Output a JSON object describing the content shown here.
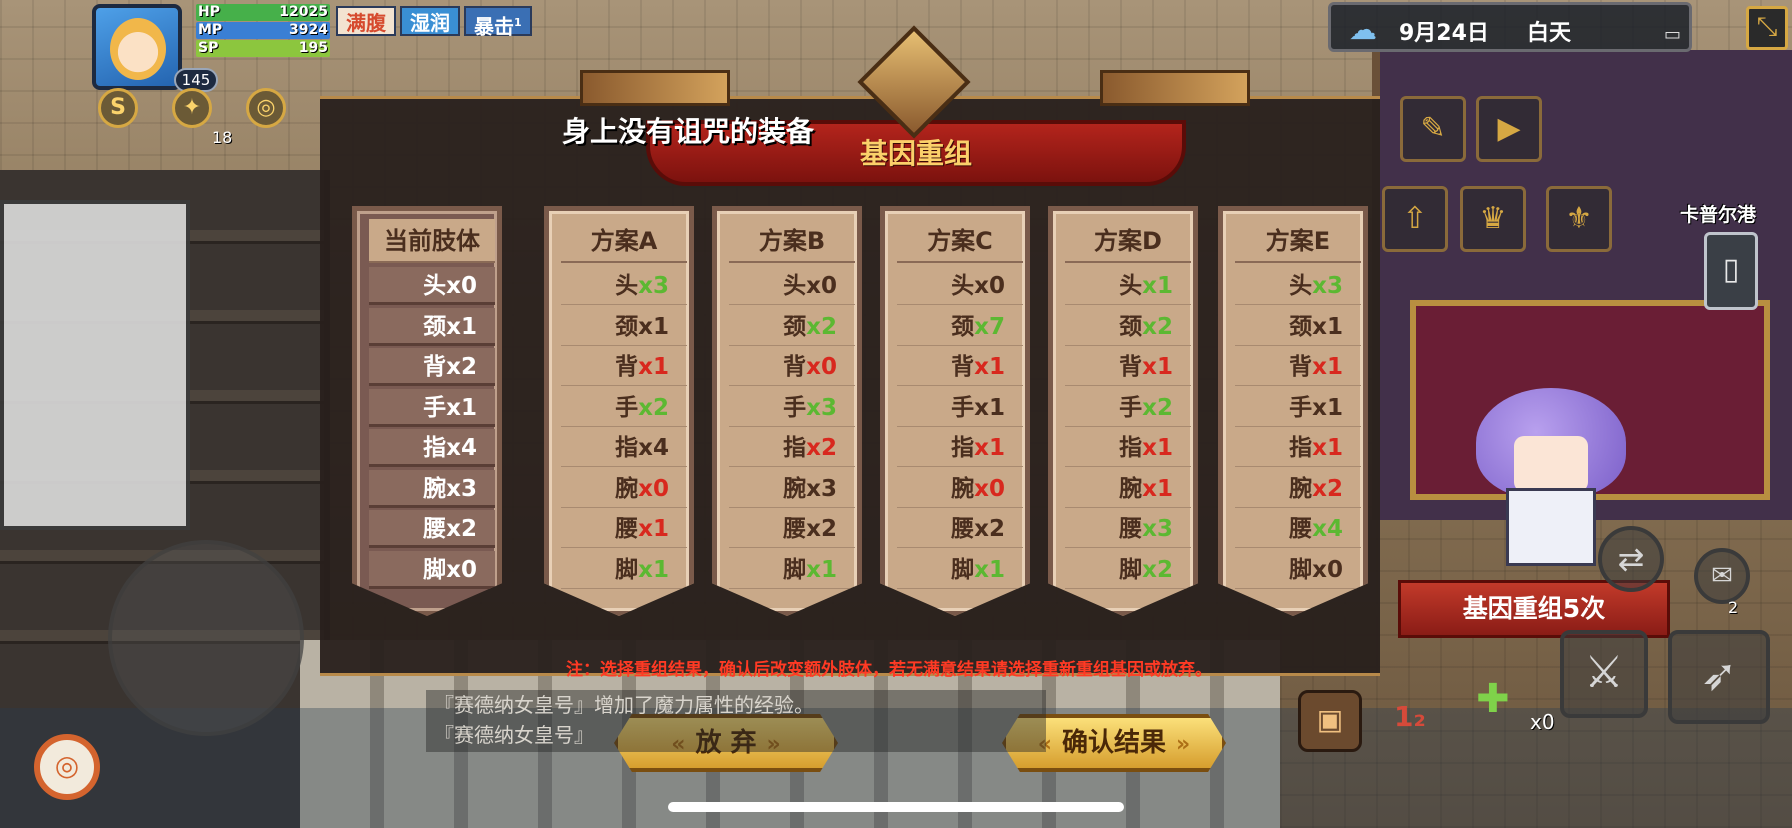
{
  "hud": {
    "level": "145",
    "stats": [
      {
        "label": "HP",
        "value": "12025",
        "fill": 1.0,
        "color": "#46b04a"
      },
      {
        "label": "MP",
        "value": "3924",
        "fill": 1.0,
        "color": "#3a7fd4"
      },
      {
        "label": "SP",
        "value": "195",
        "fill": 1.0,
        "color": "#8cc63e"
      }
    ],
    "status_tags": [
      {
        "label": "满腹",
        "color": "#d64a2e",
        "bg": "#f3e3d0"
      },
      {
        "label": "湿润",
        "color": "#ffffff",
        "bg": "#3a8fd4"
      },
      {
        "label": "暴击",
        "color": "#ffffff",
        "bg": "#3a6fb4",
        "count": "1"
      }
    ],
    "skill_count": "18",
    "date": "9月24日",
    "time_of_day": "白天",
    "location": "卡普尔港",
    "potion_count": "x0",
    "mail_count": "2"
  },
  "modal": {
    "curse_text": "身上没有诅咒的装备",
    "title": "基因重组",
    "note": "注：选择重组结果，确认后改变额外肢体，若无满意结果请选择重新重组基因或放弃。",
    "gene_count_banner": "基因重组5次",
    "abandon_label": "放 弃",
    "confirm_label": "确认结果",
    "columns": [
      {
        "header": "当前肢体",
        "current": true,
        "rows": [
          {
            "part": "头",
            "val": "x0",
            "color": "#ffffff"
          },
          {
            "part": "颈",
            "val": "x1",
            "color": "#ffffff"
          },
          {
            "part": "背",
            "val": "x2",
            "color": "#ffffff"
          },
          {
            "part": "手",
            "val": "x1",
            "color": "#ffffff"
          },
          {
            "part": "指",
            "val": "x4",
            "color": "#ffffff"
          },
          {
            "part": "腕",
            "val": "x3",
            "color": "#ffffff"
          },
          {
            "part": "腰",
            "val": "x2",
            "color": "#ffffff"
          },
          {
            "part": "脚",
            "val": "x0",
            "color": "#ffffff"
          }
        ]
      },
      {
        "header": "方案A",
        "current": false,
        "rows": [
          {
            "part": "头",
            "val": "x3",
            "color": "#5cb832"
          },
          {
            "part": "颈",
            "val": "x1",
            "color": "#4a2e1e"
          },
          {
            "part": "背",
            "val": "x1",
            "color": "#d8281e"
          },
          {
            "part": "手",
            "val": "x2",
            "color": "#5cb832"
          },
          {
            "part": "指",
            "val": "x4",
            "color": "#4a2e1e"
          },
          {
            "part": "腕",
            "val": "x0",
            "color": "#d8281e"
          },
          {
            "part": "腰",
            "val": "x1",
            "color": "#d8281e"
          },
          {
            "part": "脚",
            "val": "x1",
            "color": "#5cb832"
          }
        ]
      },
      {
        "header": "方案B",
        "current": false,
        "rows": [
          {
            "part": "头",
            "val": "x0",
            "color": "#4a2e1e"
          },
          {
            "part": "颈",
            "val": "x2",
            "color": "#5cb832"
          },
          {
            "part": "背",
            "val": "x0",
            "color": "#d8281e"
          },
          {
            "part": "手",
            "val": "x3",
            "color": "#5cb832"
          },
          {
            "part": "指",
            "val": "x2",
            "color": "#d8281e"
          },
          {
            "part": "腕",
            "val": "x3",
            "color": "#4a2e1e"
          },
          {
            "part": "腰",
            "val": "x2",
            "color": "#4a2e1e"
          },
          {
            "part": "脚",
            "val": "x1",
            "color": "#5cb832"
          }
        ]
      },
      {
        "header": "方案C",
        "current": false,
        "rows": [
          {
            "part": "头",
            "val": "x0",
            "color": "#4a2e1e"
          },
          {
            "part": "颈",
            "val": "x7",
            "color": "#5cb832"
          },
          {
            "part": "背",
            "val": "x1",
            "color": "#d8281e"
          },
          {
            "part": "手",
            "val": "x1",
            "color": "#4a2e1e"
          },
          {
            "part": "指",
            "val": "x1",
            "color": "#d8281e"
          },
          {
            "part": "腕",
            "val": "x0",
            "color": "#d8281e"
          },
          {
            "part": "腰",
            "val": "x2",
            "color": "#4a2e1e"
          },
          {
            "part": "脚",
            "val": "x1",
            "color": "#5cb832"
          }
        ]
      },
      {
        "header": "方案D",
        "current": false,
        "rows": [
          {
            "part": "头",
            "val": "x1",
            "color": "#5cb832"
          },
          {
            "part": "颈",
            "val": "x2",
            "color": "#5cb832"
          },
          {
            "part": "背",
            "val": "x1",
            "color": "#d8281e"
          },
          {
            "part": "手",
            "val": "x2",
            "color": "#5cb832"
          },
          {
            "part": "指",
            "val": "x1",
            "color": "#d8281e"
          },
          {
            "part": "腕",
            "val": "x1",
            "color": "#d8281e"
          },
          {
            "part": "腰",
            "val": "x3",
            "color": "#5cb832"
          },
          {
            "part": "脚",
            "val": "x2",
            "color": "#5cb832"
          }
        ]
      },
      {
        "header": "方案E",
        "current": false,
        "rows": [
          {
            "part": "头",
            "val": "x3",
            "color": "#5cb832"
          },
          {
            "part": "颈",
            "val": "x1",
            "color": "#4a2e1e"
          },
          {
            "part": "背",
            "val": "x1",
            "color": "#d8281e"
          },
          {
            "part": "手",
            "val": "x1",
            "color": "#4a2e1e"
          },
          {
            "part": "指",
            "val": "x1",
            "color": "#d8281e"
          },
          {
            "part": "腕",
            "val": "x2",
            "color": "#d8281e"
          },
          {
            "part": "腰",
            "val": "x4",
            "color": "#5cb832"
          },
          {
            "part": "脚",
            "val": "x0",
            "color": "#4a2e1e"
          }
        ]
      }
    ]
  },
  "log": [
    "『赛德纳女皇号』增加了魔力属性的经验。",
    "『赛德纳女皇号』"
  ],
  "icons": {
    "weather": "rain-cloud-icon",
    "shrink": "shrink-window-icon",
    "phone": "phone-icon",
    "bag": "backpack-icon",
    "potion": "potion-icon",
    "swap": "swap-icon",
    "sword": "sword-icon",
    "bow": "bow-icon"
  }
}
